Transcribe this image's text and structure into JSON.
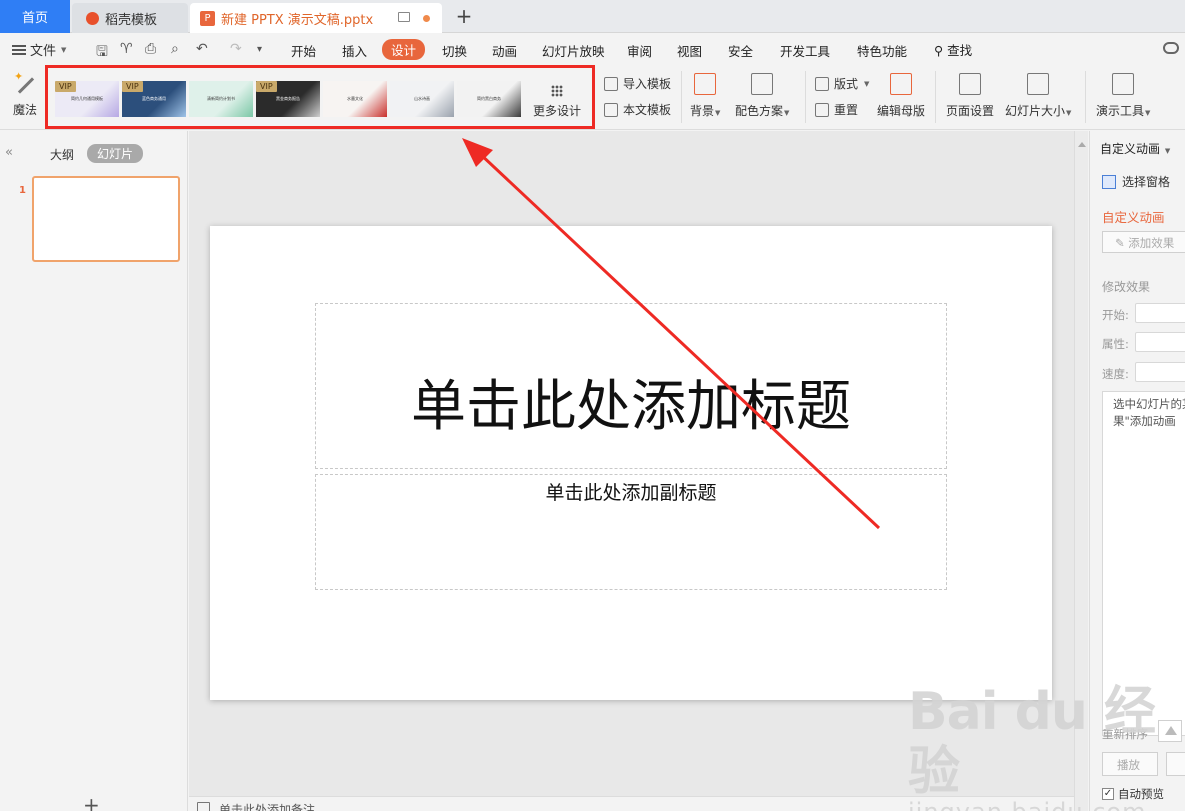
{
  "tabs": {
    "home": "首页",
    "daoke": "稻壳模板",
    "document": "新建 PPTX 演示文稿.pptx",
    "new_tab": "+"
  },
  "menu": {
    "file": "文件",
    "items": [
      "开始",
      "插入",
      "设计",
      "切换",
      "动画",
      "幻灯片放映",
      "审阅",
      "视图",
      "安全",
      "开发工具",
      "特色功能"
    ],
    "active_item": "设计",
    "search": "查找"
  },
  "ribbon": {
    "magic": "魔法",
    "templates": [
      {
        "vip": "VIP",
        "caption": "简约几何通用模板",
        "bg": "#eceaf6",
        "accent": "#b6a8e4"
      },
      {
        "vip": "VIP",
        "caption": "蓝色商务通用",
        "bg": "#2c4f7c",
        "accent": "#9fc3e8"
      },
      {
        "vip": "",
        "caption": "清新简约计划书",
        "bg": "#dff1ea",
        "accent": "#7bc7a6"
      },
      {
        "vip": "VIP",
        "caption": "黑金商务报告",
        "bg": "#2b2b2b",
        "accent": "#cfcfcf"
      },
      {
        "vip": "",
        "caption": "水墨文化",
        "bg": "#f7f4f2",
        "accent": "#c9302c"
      },
      {
        "vip": "",
        "caption": "山水诗画",
        "bg": "#f1f2f4",
        "accent": "#9aa2ad"
      },
      {
        "vip": "",
        "caption": "简约黑白商务",
        "bg": "#f2f2f2",
        "accent": "#3a3a3a"
      }
    ],
    "more_design": "更多设计",
    "import_template": "导入模板",
    "this_template": "本文模板",
    "background": "背景",
    "color_scheme": "配色方案",
    "layout": "版式",
    "reset": "重置",
    "edit_master": "编辑母版",
    "page_setup": "页面设置",
    "slide_size": "幻灯片大小",
    "presentation_tools": "演示工具"
  },
  "left_panel": {
    "outline": "大纲",
    "slides": "幻灯片",
    "slide_number": "1",
    "add": "+"
  },
  "slide": {
    "title_placeholder": "单击此处添加标题",
    "subtitle_placeholder": "单击此处添加副标题"
  },
  "notes_placeholder": "单击此处添加备注",
  "right_pane": {
    "header": "自定义动画",
    "select_pane": "选择窗格",
    "custom_animation": "自定义动画",
    "add_effect": "添加效果",
    "modify_effect": "修改效果",
    "start_label": "开始:",
    "property_label": "属性:",
    "speed_label": "速度:",
    "description": "选中幻灯片的某\n果\"添加动画",
    "reorder": "重新排序",
    "play": "播放",
    "auto_preview": "自动预览"
  },
  "watermark": {
    "brand": "Bai du 经验",
    "url": "jingyan.baidu.com"
  },
  "colors": {
    "accent": "#e8663c",
    "highlight_frame": "#ee2a24",
    "home_tab": "#2f7ef5"
  }
}
